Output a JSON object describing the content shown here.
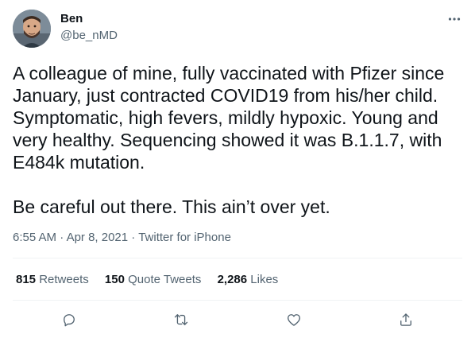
{
  "author": {
    "name": "Ben",
    "handle": "@be_nMD"
  },
  "tweet": {
    "paragraphs": [
      "A colleague of mine, fully vaccinated with Pfizer since January, just contracted COVID19 from his/her child. Symptomatic, high fevers, mildly hypoxic. Young and very healthy. Sequencing showed it was B.1.1.7, with E484k mutation.",
      "Be careful out there. This ain’t over yet."
    ]
  },
  "meta": {
    "time": "6:55 AM",
    "date": "Apr 8, 2021",
    "source": "Twitter for iPhone",
    "separator": " · "
  },
  "stats": {
    "retweets": {
      "count": "815",
      "label": "Retweets"
    },
    "quote_tweets": {
      "count": "150",
      "label": "Quote Tweets"
    },
    "likes": {
      "count": "2,286",
      "label": "Likes"
    }
  },
  "icons": {
    "more": "more-options-icon",
    "reply": "reply-icon",
    "retweet": "retweet-icon",
    "like": "like-icon",
    "share": "share-icon"
  },
  "colors": {
    "text": "#0f1419",
    "secondary": "#536471",
    "divider": "#eff3f4"
  }
}
